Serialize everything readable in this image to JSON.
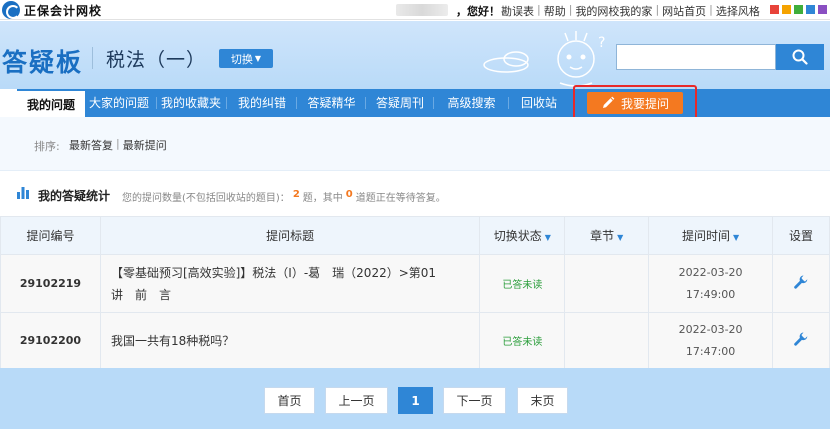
{
  "topbar": {
    "logo_text": "正保会计网校",
    "greeting": "，您好！",
    "links": [
      "勘误表",
      "帮助",
      "我的网校我的家",
      "网站首页",
      "选择风格"
    ],
    "swatches": [
      "#e8433a",
      "#f5a300",
      "#3fae3b",
      "#2f86d6",
      "#8a4fc2"
    ]
  },
  "header": {
    "site_title": "答疑板",
    "course_title": "税法（一）",
    "switch_label": "切换",
    "search_placeholder": ""
  },
  "nav": {
    "items": [
      "我的问题",
      "大家的问题",
      "我的收藏夹",
      "我的纠错",
      "答疑精华",
      "答疑周刊",
      "高级搜索",
      "回收站"
    ],
    "ask_label": "我要提问"
  },
  "sort": {
    "label": "排序:",
    "options": [
      "最新答复",
      "最新提问"
    ]
  },
  "stats": {
    "title": "我的答疑统计",
    "desc_prefix": "您的提问数量(不包括回收站的题目)：",
    "total": "2",
    "desc_mid": "题，其中",
    "waiting": "0",
    "desc_suffix": "道题正在等待答复。"
  },
  "table": {
    "headers": [
      "提问编号",
      "提问标题",
      "切换状态",
      "章节",
      "提问时间",
      "设置"
    ],
    "rows": [
      {
        "id": "29102219",
        "title_line1": "【零基础预习[高效实验]】税法（Ⅰ）-葛　瑞（2022）>第01",
        "title_line2": "讲　前　言",
        "status": "已答未读",
        "chapter": "",
        "date": "2022-03-20",
        "time": "17:49:00"
      },
      {
        "id": "29102200",
        "title_line1": "我国一共有18种税吗？",
        "title_line2": "",
        "status": "已答未读",
        "chapter": "",
        "date": "2022-03-20",
        "time": "17:47:00"
      }
    ]
  },
  "pager": {
    "first": "首页",
    "prev": "上一页",
    "current": "1",
    "next": "下一页",
    "last": "末页"
  }
}
